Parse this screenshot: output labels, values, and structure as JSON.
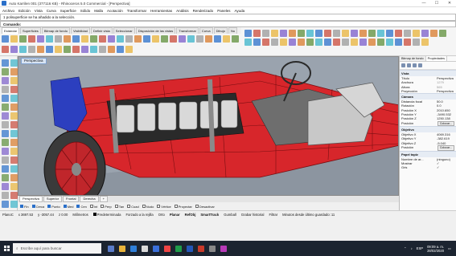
{
  "window": {
    "title": "Auto Karrilen 001 (377116 KB) - Rhinoceros 5.0 Commercial - [Perspectiva]",
    "minimize": "—",
    "maximize": "☐",
    "close": "✕"
  },
  "menu": [
    "Archivo",
    "Edición",
    "Vista",
    "Curva",
    "Superficie",
    "Sólido",
    "Malla",
    "Acotación",
    "Transformar",
    "Herramientas",
    "Análisis",
    "Renderizado",
    "Paneles",
    "Ayuda"
  ],
  "command_history": "1 polisuperficie se ha añadido a la selección.",
  "command_prompt": "Comando:",
  "toolbar_tabs": [
    {
      "label": "Estándar",
      "active": true
    },
    {
      "label": "Superficies",
      "active": false
    },
    {
      "label": "Bitmap de fondo",
      "active": false
    },
    {
      "label": "Visibilidad",
      "active": false
    },
    {
      "label": "Definir vista",
      "active": false
    },
    {
      "label": "Seleccionar",
      "active": false
    },
    {
      "label": "Disposición de las vistas",
      "active": false
    },
    {
      "label": "Transformar",
      "active": false
    },
    {
      "label": "Curva",
      "active": false
    },
    {
      "label": "Dibujo",
      "active": false
    },
    {
      "label": "Nu",
      "active": false
    }
  ],
  "viewport": {
    "label": "Perspectiva"
  },
  "viewport_tabs": [
    {
      "label": "Perspectiva",
      "active": true
    },
    {
      "label": "Superior",
      "active": false
    },
    {
      "label": "Frontal",
      "active": false
    },
    {
      "label": "Derecha",
      "active": false
    },
    {
      "label": "+",
      "active": false
    }
  ],
  "osnaps": [
    {
      "label": "Fin",
      "on": true
    },
    {
      "label": "Cerca",
      "on": true
    },
    {
      "label": "Punto",
      "on": true
    },
    {
      "label": "Med",
      "on": true
    },
    {
      "label": "Cen",
      "on": true
    },
    {
      "label": "Int",
      "on": false
    },
    {
      "label": "Perp",
      "on": false
    },
    {
      "label": "Tan",
      "on": false
    },
    {
      "label": "Cuad",
      "on": false
    },
    {
      "label": "Nudo",
      "on": false
    },
    {
      "label": "Vértice",
      "on": false
    },
    {
      "label": "Proyectar",
      "on": false
    },
    {
      "label": "Desactivar",
      "on": false
    }
  ],
  "statusbar": {
    "cplane": "PlanoC",
    "x": "x 3697.53",
    "y": "y -3057.44",
    "z": "z 0.00",
    "units": "Milímetros",
    "layer": "Predeterminada",
    "grid_snap": "Forzado a la rejilla",
    "ortho": "Orto",
    "planar": "Planar",
    "osnap": "RefObj",
    "smarttrack": "SmartTrack",
    "gumball": "Gumball",
    "history": "Grabar historial",
    "filter": "Filtrar",
    "saved": "Minutos desde último guardado: 11"
  },
  "right_panel": {
    "tabs": [
      {
        "label": "Bitmap de fondo",
        "active": false
      },
      {
        "label": "Propiedades",
        "active": true
      }
    ],
    "view_section": "Vista",
    "view_rows": [
      {
        "k": "Título",
        "v": "Perspectiva",
        "dim": false
      },
      {
        "k": "Anchura",
        "v": "1279",
        "dim": true
      },
      {
        "k": "Altura",
        "v": "565",
        "dim": true
      },
      {
        "k": "Proyección",
        "v": "Perspectiva",
        "dim": false
      }
    ],
    "camera_section": "Cámara",
    "camera_rows": [
      {
        "k": "Distancia focal",
        "v": "50.0"
      },
      {
        "k": "Rotación",
        "v": "0.0"
      },
      {
        "k": "Posición X",
        "v": "2010.650"
      },
      {
        "k": "Posición Y",
        "v": "-3490.532"
      },
      {
        "k": "Posición Z",
        "v": "1250.138"
      }
    ],
    "camera_position": "Posición",
    "place_button": "Colocar...",
    "target_section": "Objetivo",
    "target_rows": [
      {
        "k": "Objetivo X",
        "v": "4069.316"
      },
      {
        "k": "Objetivo Y",
        "v": "-382.619"
      },
      {
        "k": "Objetivo Z",
        "v": "-5.040"
      }
    ],
    "target_position": "Posición",
    "wallpaper_section": "Papel tapiz",
    "wallpaper_rows": [
      {
        "k": "Nombre de ar...",
        "v": "(ninguno)"
      },
      {
        "k": "Mostrar",
        "v": "✓"
      },
      {
        "k": "Gris",
        "v": "✓"
      }
    ]
  },
  "taskbar": {
    "search_placeholder": "Escribe aquí para buscar",
    "time": "09:09 a. m.",
    "date": "28/02/2020",
    "lang": "ESP"
  },
  "colors": {
    "car_body": "#d7262b",
    "blue_part": "#2c3fbf",
    "viewport_bg": "#9aa3ae",
    "accent": "#2a6fc9"
  }
}
